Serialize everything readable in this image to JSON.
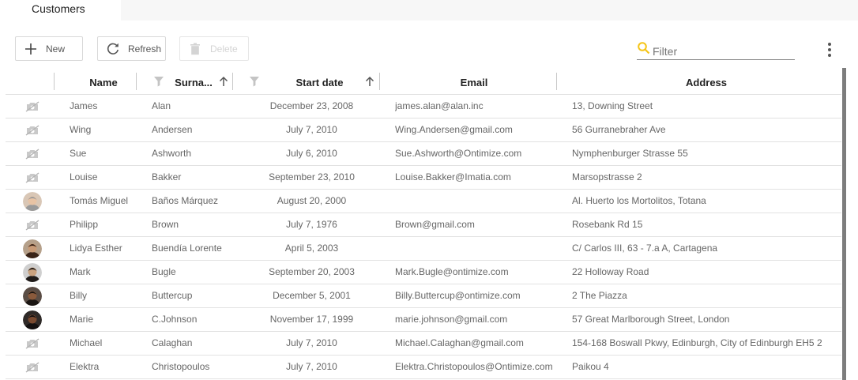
{
  "tabs": [
    {
      "label": "Customers",
      "selected": true
    }
  ],
  "toolbar": {
    "new_label": "New",
    "refresh_label": "Refresh",
    "delete_label": "Delete",
    "delete_disabled": true
  },
  "filter": {
    "placeholder": "Filter",
    "value": ""
  },
  "colors": {
    "accent": "#f5c518",
    "text": "#666666",
    "header_text": "#222222",
    "disabled": "#d4d4d4"
  },
  "table": {
    "columns": [
      {
        "key": "avatar",
        "label": ""
      },
      {
        "key": "name",
        "label": "Name"
      },
      {
        "key": "surname",
        "label": "Surna...",
        "filter_icon": true,
        "sort": "ascending"
      },
      {
        "key": "start_date",
        "label": "Start date",
        "filter_icon": true,
        "sort": "ascending"
      },
      {
        "key": "email",
        "label": "Email"
      },
      {
        "key": "address",
        "label": "Address"
      }
    ],
    "rows": [
      {
        "avatar": "no-photo-icon",
        "name": "James",
        "surname": "Alan",
        "start_date": "December 23, 2008",
        "email": "james.alan@alan.inc",
        "address": "13, Downing Street"
      },
      {
        "avatar": "no-photo-icon",
        "name": "Wing",
        "surname": "Andersen",
        "start_date": "July 7, 2010",
        "email": "Wing.Andersen@gmail.com",
        "address": "56 Gurranebraher Ave"
      },
      {
        "avatar": "no-photo-icon",
        "name": "Sue",
        "surname": "Ashworth",
        "start_date": "July 6, 2010",
        "email": "Sue.Ashworth@Ontimize.com",
        "address": "Nymphenburger Strasse 55"
      },
      {
        "avatar": "no-photo-icon",
        "name": "Louise",
        "surname": "Bakker",
        "start_date": "September 23, 2010",
        "email": "Louise.Bakker@Imatia.com",
        "address": "Marsopstrasse 2"
      },
      {
        "avatar": "photo-avatar",
        "name": "Tomás Miguel",
        "surname": "Baños Márquez",
        "start_date": "August 20, 2000",
        "email": "",
        "address": "Al. Huerto los Mortolitos, Totana"
      },
      {
        "avatar": "no-photo-icon",
        "name": "Philipp",
        "surname": "Brown",
        "start_date": "July 7, 1976",
        "email": "Brown@gmail.com",
        "address": "Rosebank Rd 15"
      },
      {
        "avatar": "photo-avatar",
        "name": "Lidya Esther",
        "surname": "Buendía Lorente",
        "start_date": "April 5, 2003",
        "email": "",
        "address": "C/ Carlos III, 63 - 7.a A, Cartagena"
      },
      {
        "avatar": "photo-avatar",
        "name": "Mark",
        "surname": "Bugle",
        "start_date": "September 20, 2003",
        "email": "Mark.Bugle@ontimize.com",
        "address": "22 Holloway Road"
      },
      {
        "avatar": "photo-avatar",
        "name": "Billy",
        "surname": "Buttercup",
        "start_date": "December 5, 2001",
        "email": "Billy.Buttercup@ontimize.com",
        "address": "2 The Piazza"
      },
      {
        "avatar": "photo-avatar",
        "name": "Marie",
        "surname": "C.Johnson",
        "start_date": "November 17, 1999",
        "email": "marie.johnson@gmail.com",
        "address": "57 Great Marlborough Street, London"
      },
      {
        "avatar": "no-photo-icon",
        "name": "Michael",
        "surname": "Calaghan",
        "start_date": "July 7, 2010",
        "email": "Michael.Calaghan@gmail.com",
        "address": "154-168 Boswall Pkwy, Edinburgh, City of Edinburgh EH5 2"
      },
      {
        "avatar": "no-photo-icon",
        "name": "Elektra",
        "surname": "Christopoulos",
        "start_date": "July 7, 2010",
        "email": "Elektra.Christopoulos@Ontimize.com",
        "address": "Paikou 4"
      }
    ]
  }
}
